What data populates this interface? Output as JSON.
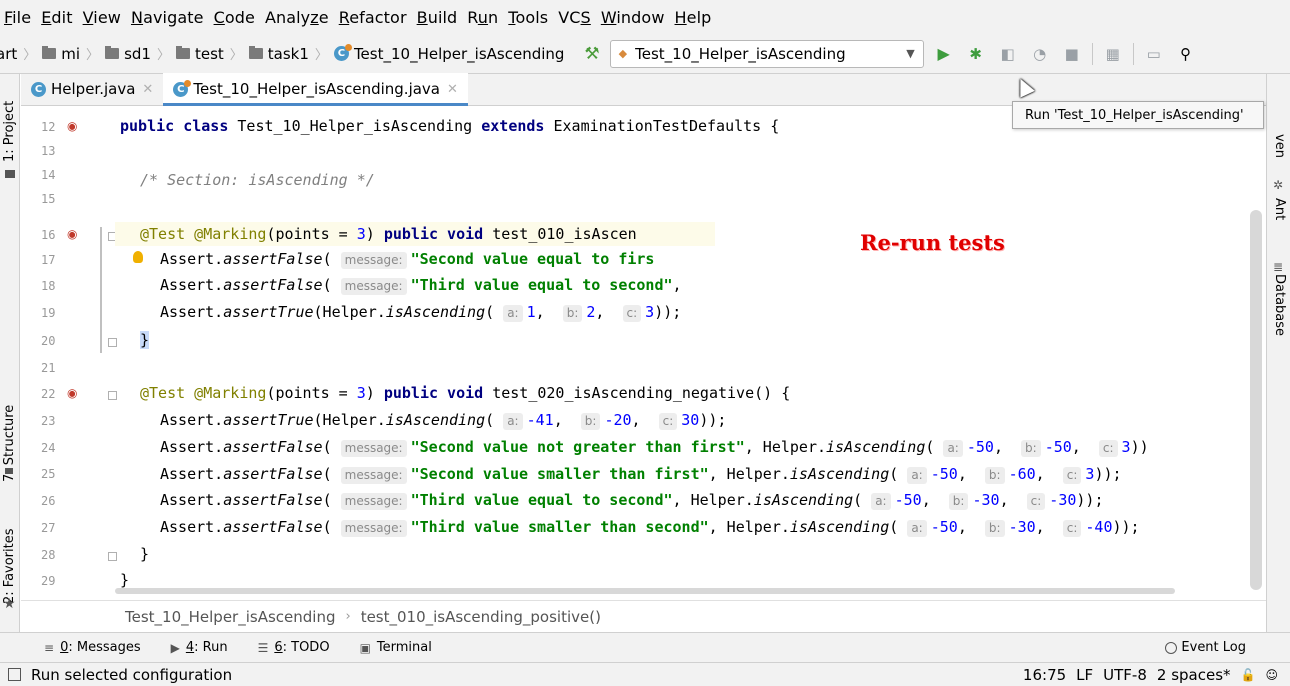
{
  "menu": [
    "File",
    "Edit",
    "View",
    "Navigate",
    "Code",
    "Analyze",
    "Refactor",
    "Build",
    "Run",
    "Tools",
    "VCS",
    "Window",
    "Help"
  ],
  "menu_mnemonic": [
    "F",
    "E",
    "V",
    "N",
    "C",
    "z",
    "R",
    "B",
    "u",
    "T",
    "S",
    "W",
    "H"
  ],
  "nav": {
    "crumbs": [
      "art",
      "mi",
      "sd1",
      "test",
      "task1",
      "Test_10_Helper_isAscending"
    ],
    "run_config": "Test_10_Helper_isAscending"
  },
  "tooltip": "Run 'Test_10_Helper_isAscending'",
  "left_tabs": [
    "1: Project",
    "7: Structure",
    "2: Favorites"
  ],
  "right_tabs": [
    "ven",
    "Ant",
    "Database"
  ],
  "editor_tabs": [
    {
      "label": "Helper.java",
      "active": false
    },
    {
      "label": "Test_10_Helper_isAscending.java",
      "active": true
    }
  ],
  "line_numbers": [
    "12",
    "13",
    "14",
    "15",
    "16",
    "17",
    "18",
    "19",
    "20",
    "21",
    "22",
    "23",
    "24",
    "25",
    "26",
    "27",
    "28",
    "29"
  ],
  "code": {
    "l12_a": "public class",
    "l12_b": " Test_10_Helper_isAscending ",
    "l12_c": "extends",
    "l12_d": " ExaminationTestDefaults {",
    "l14": "/* Section: isAscending */",
    "l16_a": "@Test @Marking",
    "l16_b": "(points = ",
    "l16_c": "3",
    "l16_d": ") ",
    "l16_e": "public void",
    "l16_f": " test_010_isAscen",
    "l17_a": "Assert.",
    "l17_b": "assertFalse",
    "l17_c": "( ",
    "l17_hint": "message:",
    "l17_str": "\"Second value equal to firs",
    "l18_a": "Assert.",
    "l18_b": "assertFalse",
    "l18_c": "( ",
    "l18_hint": "message:",
    "l18_str": "\"Third value equal to second\"",
    "l18_d": ",",
    "l19_a": "Assert.",
    "l19_b": "assertTrue",
    "l19_c": "(Helper.",
    "l19_d": "isAscending",
    "l19_e": "( ",
    "l19_h1": "a:",
    "l19_n1": "1",
    "l19_s1": ",  ",
    "l19_h2": "b:",
    "l19_n2": "2",
    "l19_s2": ",  ",
    "l19_h3": "c:",
    "l19_n3": "3",
    "l19_end": "));",
    "l20": "}",
    "l22_a": "@Test @Marking",
    "l22_b": "(points = ",
    "l22_c": "3",
    "l22_d": ") ",
    "l22_e": "public void",
    "l22_f": " test_020_isAscending_negative() {",
    "l23": {
      "a": "Assert.",
      "m": "assertTrue",
      "p": "(Helper.",
      "f": "isAscending",
      "o": "( ",
      "h1": "a:",
      "n1": "-41",
      "s": ",  ",
      "h2": "b:",
      "n2": "-20",
      "h3": "c:",
      "n3": "30",
      "end": "));"
    },
    "l24": {
      "a": "Assert.",
      "m": "assertFalse",
      "o": "( ",
      "hm": "message:",
      "str": "\"Second value not greater than first\"",
      "p": ", Helper.",
      "f": "isAscending",
      "o2": "( ",
      "h1": "a:",
      "n1": "-50",
      "s": ",  ",
      "h2": "b:",
      "n2": "-50",
      "h3": "c:",
      "n3": "3",
      "end": "))"
    },
    "l25": {
      "a": "Assert.",
      "m": "assertFalse",
      "o": "( ",
      "hm": "message:",
      "str": "\"Second value smaller than first\"",
      "p": ", Helper.",
      "f": "isAscending",
      "o2": "( ",
      "h1": "a:",
      "n1": "-50",
      "s": ",  ",
      "h2": "b:",
      "n2": "-60",
      "h3": "c:",
      "n3": "3",
      "end": "));"
    },
    "l26": {
      "a": "Assert.",
      "m": "assertFalse",
      "o": "( ",
      "hm": "message:",
      "str": "\"Third value equal to second\"",
      "p": ", Helper.",
      "f": "isAscending",
      "o2": "( ",
      "h1": "a:",
      "n1": "-50",
      "s": ",  ",
      "h2": "b:",
      "n2": "-30",
      "h3": "c:",
      "n3": "-30",
      "end": "));"
    },
    "l27": {
      "a": "Assert.",
      "m": "assertFalse",
      "o": "( ",
      "hm": "message:",
      "str": "\"Third value smaller than second\"",
      "p": ", Helper.",
      "f": "isAscending",
      "o2": "( ",
      "h1": "a:",
      "n1": "-50",
      "s": ",  ",
      "h2": "b:",
      "n2": "-30",
      "h3": "c:",
      "n3": "-40",
      "end": "));"
    },
    "l28": "}",
    "l29": "}"
  },
  "overlay_text": "Re-run tests",
  "editor_breadcrumb": [
    "Test_10_Helper_isAscending",
    "test_010_isAscending_positive()"
  ],
  "tool_windows": [
    {
      "icon": "messages-icon",
      "num": "0",
      "label": ": Messages"
    },
    {
      "icon": "run-icon",
      "num": "4",
      "label": ": Run"
    },
    {
      "icon": "todo-icon",
      "num": "6",
      "label": ": TODO"
    },
    {
      "icon": "terminal-icon",
      "num": "",
      "label": "Terminal"
    }
  ],
  "event_log": "Event Log",
  "status": {
    "message": "Run selected configuration",
    "position": "16:75",
    "line_sep": "LF",
    "encoding": "UTF-8",
    "indent": "2 spaces*"
  },
  "colors": {
    "run_green": "#3e9d3e",
    "overlay_red": "#e00000",
    "accent": "#4a88c7"
  }
}
